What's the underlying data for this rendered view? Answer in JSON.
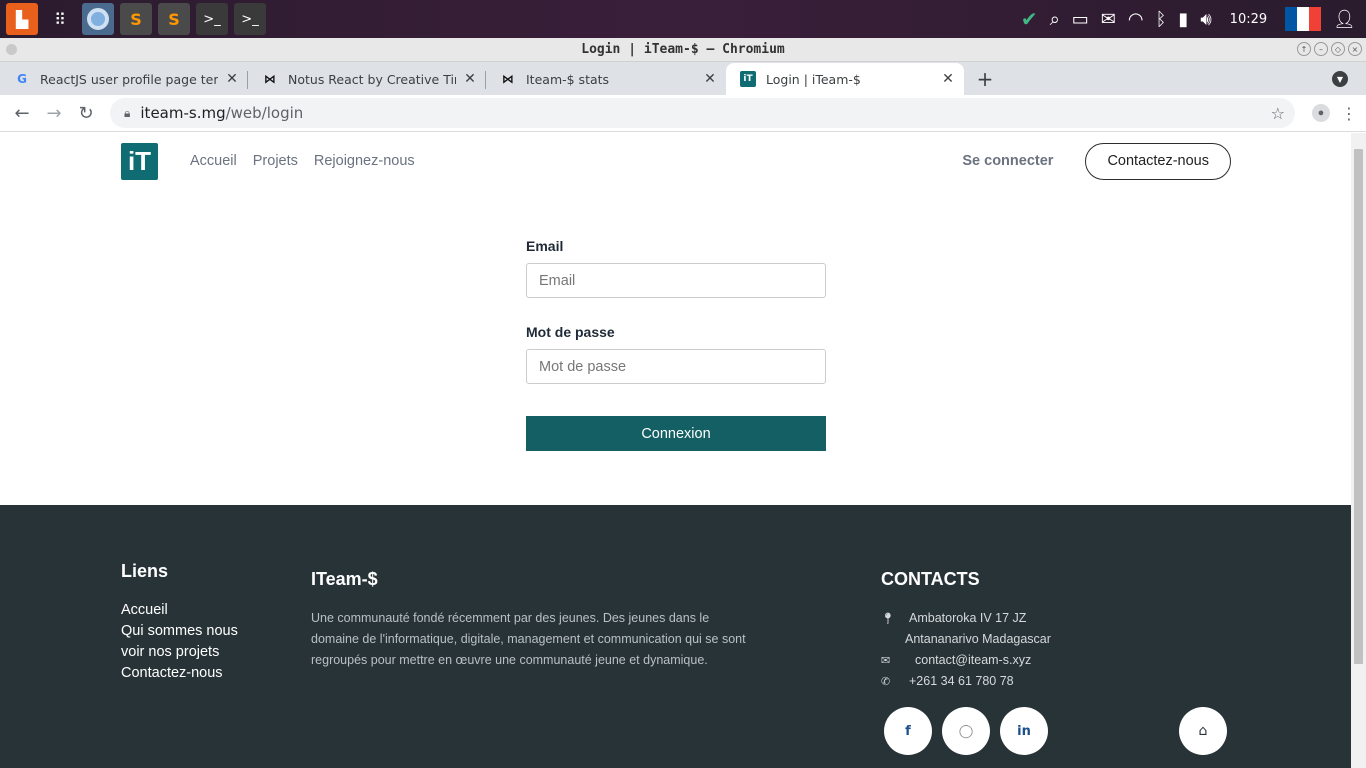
{
  "desktop": {
    "clock": "10:29",
    "flag_colors": [
      "#0055a4",
      "#ffffff",
      "#ef4135"
    ]
  },
  "window": {
    "title": "Login | iTeam-$ – Chromium"
  },
  "tabs": [
    {
      "favicon": "G",
      "label": "ReactJS user profile page templ",
      "favicon_color": "#4285f4"
    },
    {
      "favicon": "⋈",
      "label": "Notus React by Creative Tim | F",
      "favicon_color": "#111"
    },
    {
      "favicon": "⋈",
      "label": "Iteam-$ stats",
      "favicon_color": "#111"
    },
    {
      "favicon": "iT",
      "label": "Login | iTeam-$",
      "favicon_color": "#0f6c73",
      "active": true
    }
  ],
  "address": {
    "host": "iteam-s.mg",
    "path": "/web/login"
  },
  "site_nav": {
    "logo_text": "iT",
    "links": [
      "Accueil",
      "Projets",
      "Rejoignez-nous"
    ],
    "signin": "Se connecter",
    "contact": "Contactez-nous"
  },
  "login": {
    "email_label": "Email",
    "email_placeholder": "Email",
    "password_label": "Mot de passe",
    "password_placeholder": "Mot de passe",
    "submit": "Connexion"
  },
  "footer": {
    "links_title": "Liens",
    "links": [
      "Accueil",
      "Qui sommes nous",
      "voir nos projets",
      "Contactez-nous"
    ],
    "about_title": "ITeam-$",
    "about_text": "Une communauté fondé récemment par des jeunes. Des jeunes dans le domaine de l'informatique,  digitale, management et  communication qui se sont regroupés pour mettre en œuvre une communauté jeune et dynamique.",
    "contacts_title": "CONTACTS",
    "address_line1": "Ambatoroka IV 17 JZ",
    "address_line2": "Antananarivo Madagascar",
    "email": "contact@iteam-s.xyz",
    "phone": "+261 34 61 780 78",
    "social": {
      "facebook": "f",
      "github": "◯",
      "linkedin": "in"
    }
  }
}
